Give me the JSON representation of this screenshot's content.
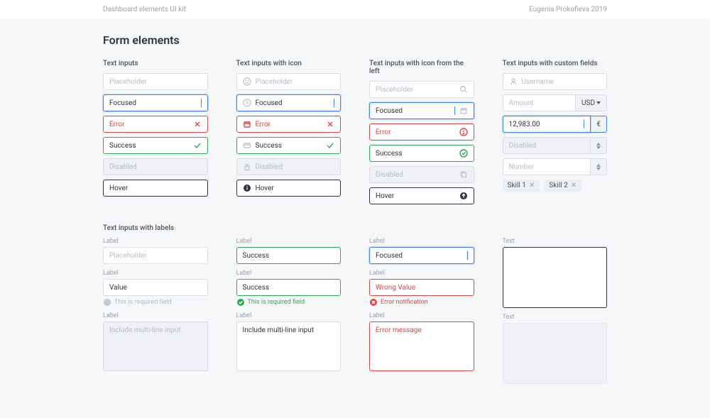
{
  "header": {
    "title": "Dashboard elements UI kit",
    "credit": "Eugenia Prokofieva 2019"
  },
  "page_title": "Form elements",
  "c1": {
    "heading": "Text inputs",
    "placeholder": "Placeholder",
    "focused": "Focused",
    "error": "Error",
    "success": "Success",
    "disabled": "Disabled",
    "hover": "Hover"
  },
  "c2": {
    "heading": "Text inputs with icon",
    "placeholder": "Placeholder",
    "focused": "Focused",
    "error": "Error",
    "success": "Success",
    "disabled": "Disabled",
    "hover": "Hover"
  },
  "c3": {
    "heading": "Text inputs with icon from the left",
    "placeholder": "Placeholder",
    "focused": "Focused",
    "error": "Error",
    "success": "Success",
    "disabled": "Disabled",
    "hover": "Hover"
  },
  "c4": {
    "heading": "Text inputs with custom fields",
    "username": "Username",
    "amount": "Amount",
    "currency": "USD",
    "value": "12,983.00",
    "euro": "€",
    "disabled": "Disabled",
    "number": "Number",
    "skill1": "Skill 1",
    "skill2": "Skill 2"
  },
  "labels_heading": "Text inputs with labels",
  "l1": {
    "label": "Label",
    "placeholder": "Placeholder",
    "value": "Value",
    "hint": "This is required field"
  },
  "l2": {
    "label": "Label",
    "success": "Success",
    "hint": "This is required field",
    "multiline": "Include multi-line input"
  },
  "l3": {
    "label": "Label",
    "focused": "Focused",
    "wrong": "Wrong Value",
    "hint": "Error notification",
    "errormsg": "Error message"
  },
  "l4": {
    "text_label": "Text"
  }
}
